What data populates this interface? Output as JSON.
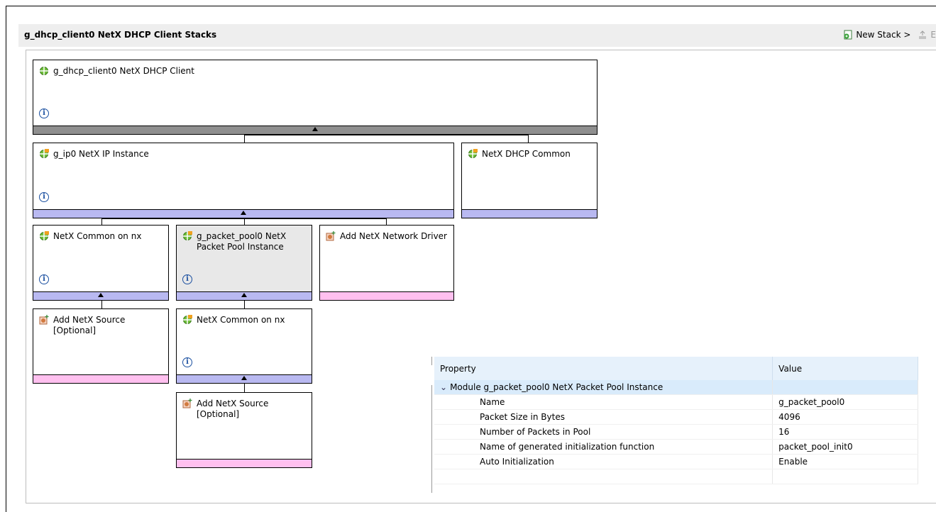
{
  "header": {
    "title": "g_dhcp_client0 NetX DHCP Client Stacks",
    "new_stack_label": "New Stack >",
    "extract_label": "E"
  },
  "blocks": {
    "dhcp_client": {
      "label": "g_dhcp_client0 NetX DHCP Client"
    },
    "ip_instance": {
      "label": "g_ip0 NetX IP Instance"
    },
    "dhcp_common": {
      "label": "NetX DHCP Common"
    },
    "netx_common_1": {
      "label": "NetX Common on nx"
    },
    "packet_pool": {
      "label": "g_packet_pool0 NetX Packet Pool Instance"
    },
    "add_network_driver": {
      "label": "Add NetX Network Driver"
    },
    "add_source_1": {
      "label": "Add NetX Source [Optional]"
    },
    "netx_common_2": {
      "label": "NetX Common on nx"
    },
    "add_source_2": {
      "label": "Add NetX Source [Optional]"
    }
  },
  "properties": {
    "col_property": "Property",
    "col_value": "Value",
    "module_label": "Module g_packet_pool0 NetX Packet Pool Instance",
    "rows": [
      {
        "name": "Name",
        "value": "g_packet_pool0"
      },
      {
        "name": "Packet Size in Bytes",
        "value": "4096"
      },
      {
        "name": "Number of Packets in Pool",
        "value": "16"
      },
      {
        "name": "Name of generated initialization function",
        "value": "packet_pool_init0"
      },
      {
        "name": "Auto Initialization",
        "value": "Enable"
      }
    ]
  },
  "colors": {
    "gray_bar": "#8f8f8f",
    "blue_bar": "#b9b9f1",
    "pink_bar": "#ffc0ef",
    "selected_bg": "#e8e8e8",
    "header_bg": "#e6f1fb"
  }
}
